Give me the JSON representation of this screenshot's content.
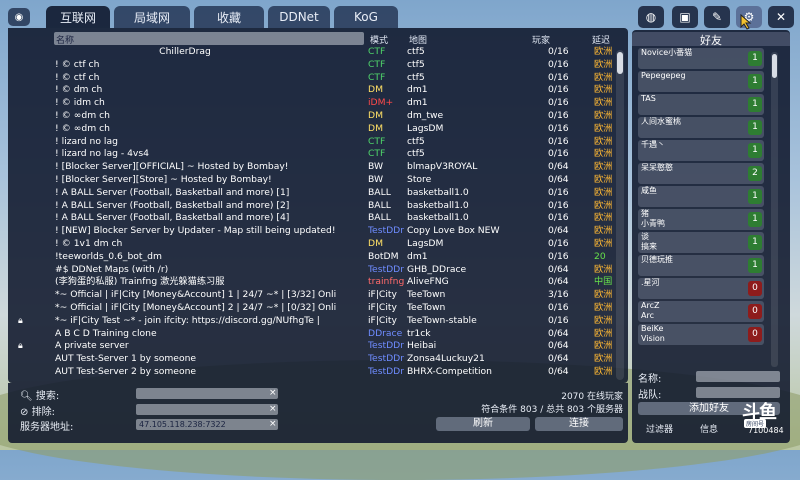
{
  "tabs": [
    {
      "label": "互联网",
      "active": true
    },
    {
      "label": "局域网",
      "active": false
    },
    {
      "label": "收藏",
      "active": false
    },
    {
      "label": "DDNet",
      "active": false
    },
    {
      "label": "KoG",
      "active": false
    }
  ],
  "top_icons": [
    "globe-icon",
    "film-icon",
    "pencil-icon",
    "gear-icon",
    "close-icon"
  ],
  "header": {
    "name": "名称",
    "mode": "模式",
    "map": "地图",
    "players": "玩家",
    "ping": "延迟"
  },
  "colors": {
    "ctf": "#4fd46a",
    "dm": "#ffe066",
    "idm": "#ff4a4a",
    "ball": "#ffffff",
    "bw": "#ffffff",
    "testddr": "#6f8cff",
    "botdm": "#ffffff",
    "ddrace": "#6f8cff",
    "trainfng": "#ff6a6a",
    "icity": "#ffffff",
    "ping_eu": "#ffb833",
    "ping_cn": "#66e04a"
  },
  "servers": [
    {
      "name": "ChillerDrag",
      "mode": "CTF",
      "mc": "ctf",
      "map": "ctf5",
      "players": "0/16",
      "ping": "欧洲",
      "pc": "ping_eu",
      "lock": false,
      "indent": "center"
    },
    {
      "name": "!                                                    © ctf ch",
      "mode": "CTF",
      "mc": "ctf",
      "map": "ctf5",
      "players": "0/16",
      "ping": "欧洲",
      "pc": "ping_eu",
      "lock": false
    },
    {
      "name": "!                                                    © ctf ch",
      "mode": "CTF",
      "mc": "ctf",
      "map": "ctf5",
      "players": "0/16",
      "ping": "欧洲",
      "pc": "ping_eu",
      "lock": false
    },
    {
      "name": "!                                                    © dm ch",
      "mode": "DM",
      "mc": "dm",
      "map": "dm1",
      "players": "0/16",
      "ping": "欧洲",
      "pc": "ping_eu",
      "lock": false
    },
    {
      "name": "!                                                    © idm ch",
      "mode": "iDM+",
      "mc": "idm",
      "map": "dm1",
      "players": "0/16",
      "ping": "欧洲",
      "pc": "ping_eu",
      "lock": false
    },
    {
      "name": "!                                                    © ∞dm ch",
      "mode": "DM",
      "mc": "dm",
      "map": "dm_twe",
      "players": "0/16",
      "ping": "欧洲",
      "pc": "ping_eu",
      "lock": false
    },
    {
      "name": "!                                                    © ∞dm ch",
      "mode": "DM",
      "mc": "dm",
      "map": "LagsDM",
      "players": "0/16",
      "ping": "欧洲",
      "pc": "ping_eu",
      "lock": false
    },
    {
      "name": "!                 lizard no lag",
      "mode": "CTF",
      "mc": "ctf",
      "map": "ctf5",
      "players": "0/16",
      "ping": "欧洲",
      "pc": "ping_eu",
      "lock": false
    },
    {
      "name": "!                 lizard no lag - 4vs4",
      "mode": "CTF",
      "mc": "ctf",
      "map": "ctf5",
      "players": "0/16",
      "ping": "欧洲",
      "pc": "ping_eu",
      "lock": false
    },
    {
      "name": "!        [Blocker Server][OFFICIAL] ~ Hosted by Bombay!",
      "mode": "BW",
      "mc": "bw",
      "map": "blmapV3ROYAL",
      "players": "0/64",
      "ping": "欧洲",
      "pc": "ping_eu",
      "lock": false
    },
    {
      "name": "!        [Blocker Server][Store] ~ Hosted by Bombay!",
      "mode": "BW",
      "mc": "bw",
      "map": "Store",
      "players": "0/64",
      "ping": "欧洲",
      "pc": "ping_eu",
      "lock": false
    },
    {
      "name": "! A BALL Server (Football, Basketball and more) [1]",
      "mode": "BALL",
      "mc": "ball",
      "map": "basketball1.0",
      "players": "0/16",
      "ping": "欧洲",
      "pc": "ping_eu",
      "lock": false
    },
    {
      "name": "! A BALL Server (Football, Basketball and more) [2]",
      "mode": "BALL",
      "mc": "ball",
      "map": "basketball1.0",
      "players": "0/16",
      "ping": "欧洲",
      "pc": "ping_eu",
      "lock": false
    },
    {
      "name": "! A BALL Server (Football, Basketball and more) [4]",
      "mode": "BALL",
      "mc": "ball",
      "map": "basketball1.0",
      "players": "0/16",
      "ping": "欧洲",
      "pc": "ping_eu",
      "lock": false
    },
    {
      "name": "! [NEW] Blocker Server by Updater - Map still being updated!",
      "mode": "TestDDr",
      "mc": "testddr",
      "map": "Copy Love Box NEW",
      "players": "0/64",
      "ping": "欧洲",
      "pc": "ping_eu",
      "lock": false
    },
    {
      "name": "! © 1v1 dm ch",
      "mode": "DM",
      "mc": "dm",
      "map": "LagsDM",
      "players": "0/16",
      "ping": "欧洲",
      "pc": "ping_eu",
      "lock": false
    },
    {
      "name": "!teeworlds_0.6_bot_dm",
      "mode": "BotDM",
      "mc": "botdm",
      "map": "dm1",
      "players": "0/16",
      "ping": "20",
      "pc": "ping_cn",
      "lock": false
    },
    {
      "name": "#$ DDNet Maps (with /r)",
      "mode": "TestDDr",
      "mc": "testddr",
      "map": "GHB_DDrace",
      "players": "0/64",
      "ping": "欧洲",
      "pc": "ping_eu",
      "lock": false
    },
    {
      "name": "(李狗蛋的私服) Trainfng 激光躲猫练习服",
      "mode": "trainfng",
      "mc": "trainfng",
      "map": "AliveFNG",
      "players": "0/64",
      "ping": "中国",
      "pc": "ping_cn",
      "lock": false
    },
    {
      "name": "*~ Official | iF|City [Money&Account] 1 | 24/7 ~* | [3/32] Onli",
      "mode": "iF|City",
      "mc": "icity",
      "map": "TeeTown",
      "players": "3/16",
      "ping": "欧洲",
      "pc": "ping_eu",
      "lock": false
    },
    {
      "name": "*~ Official | iF|City [Money&Account] 2 | 24/7 ~* | [0/32] Onli",
      "mode": "iF|City",
      "mc": "icity",
      "map": "TeeTown",
      "players": "0/16",
      "ping": "欧洲",
      "pc": "ping_eu",
      "lock": false
    },
    {
      "name": "*~ iF|City Test ~* - join ifcity: https://discord.gg/NUfhgTe |",
      "mode": "iF|City",
      "mc": "icity",
      "map": "TeeTown-stable",
      "players": "0/16",
      "ping": "欧洲",
      "pc": "ping_eu",
      "lock": true
    },
    {
      "name": "A B C D Training clone",
      "mode": "DDrace",
      "mc": "ddrace",
      "map": "tr1ck",
      "players": "0/64",
      "ping": "欧洲",
      "pc": "ping_eu",
      "lock": false
    },
    {
      "name": "A private server",
      "mode": "TestDDr",
      "mc": "testddr",
      "map": "Heibai",
      "players": "0/64",
      "ping": "欧洲",
      "pc": "ping_eu",
      "lock": true
    },
    {
      "name": "AUT Test-Server 1 by someone",
      "mode": "TestDDr",
      "mc": "testddr",
      "map": "Zonsa4Luckuy21",
      "players": "0/64",
      "ping": "欧洲",
      "pc": "ping_eu",
      "lock": false
    },
    {
      "name": "AUT Test-Server 2 by someone",
      "mode": "TestDDr",
      "mc": "testddr",
      "map": "BHRX-Competition",
      "players": "0/64",
      "ping": "欧洲",
      "pc": "ping_eu",
      "lock": false
    }
  ],
  "filters": {
    "search_label": "搜索:",
    "exclude_label": "排除:",
    "address_label": "服务器地址:",
    "address_value": "47.105.118.238:7322"
  },
  "stats": {
    "online": "2070 在线玩家",
    "matching": "符合条件 803 / 总共 803 个服务器"
  },
  "buttons": {
    "refresh": "刷新",
    "connect": "连接"
  },
  "friends": {
    "title": "好友",
    "items": [
      {
        "name": "Novice小番猫",
        "count": "1",
        "color": "g"
      },
      {
        "name": "Pepegepeg",
        "count": "1",
        "color": "g"
      },
      {
        "name": "TAS",
        "count": "1",
        "color": "g"
      },
      {
        "name": "人间水蜜桃",
        "count": "1",
        "color": "g"
      },
      {
        "name": "千遇丶",
        "count": "1",
        "color": "g"
      },
      {
        "name": "呆呆憨憨",
        "count": "2",
        "color": "g"
      },
      {
        "name": "咸鱼",
        "count": "1",
        "color": "g"
      },
      {
        "name": "猪\n小青鸭",
        "count": "1",
        "color": "g"
      },
      {
        "name": "谈\n搞来",
        "count": "1",
        "color": "g"
      },
      {
        "name": "贝德玩推",
        "count": "1",
        "color": "g"
      },
      {
        "name": ".星河",
        "count": "0",
        "color": "r"
      },
      {
        "name": "ArcZ\nArc",
        "count": "0",
        "color": "r"
      },
      {
        "name": "BeiKe\nVision",
        "count": "0",
        "color": "r"
      }
    ],
    "name_label": "名称:",
    "clan_label": "战队:",
    "add_button": "添加好友",
    "filter_label": "过滤器",
    "info_label": "信息"
  },
  "watermark": {
    "logo": "斗鱼",
    "sub": "房间号",
    "room": "7100484"
  }
}
